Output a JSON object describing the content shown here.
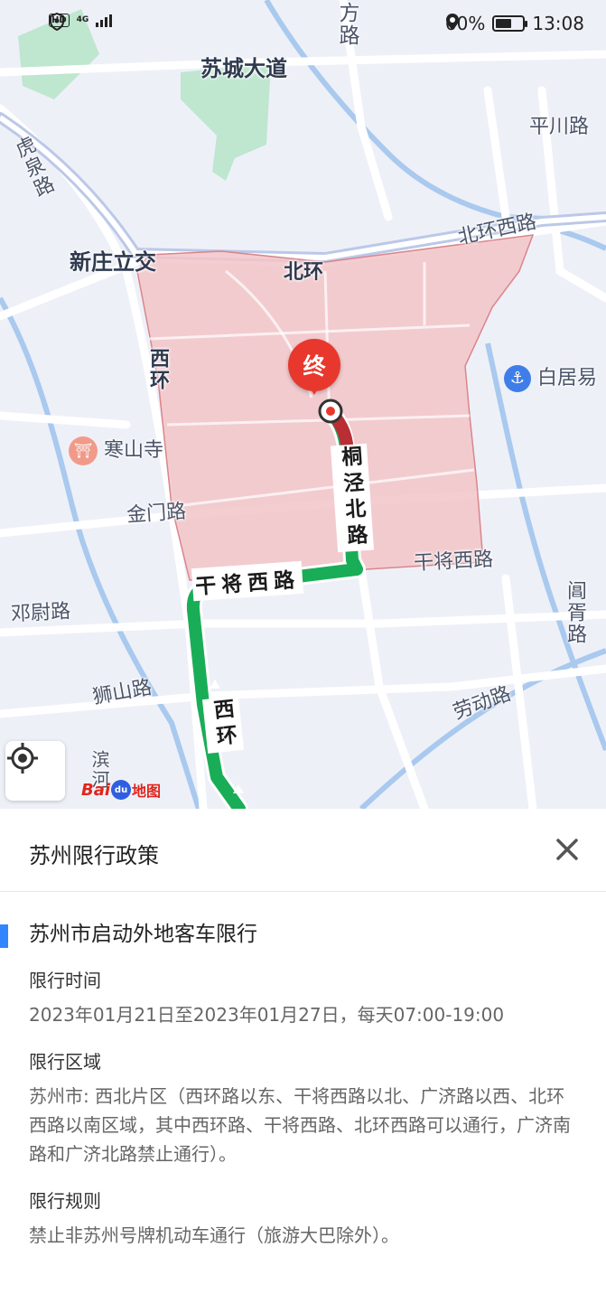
{
  "status_bar": {
    "network_badge": "HD",
    "network_type": "4G",
    "battery_percent": "60%",
    "battery_level": 0.6,
    "time": "13:08",
    "icons": [
      "hd-icon",
      "signal-icon",
      "vpn-shield-icon",
      "location-icon",
      "battery-icon"
    ]
  },
  "map": {
    "roads": {
      "fang_lu_a": "方",
      "fang_lu_b": "路",
      "sucheng_dadao": "苏城大道",
      "pingchuan_lu": "平川路",
      "huquan_lu": "虎泉路",
      "beihuan_xilu_top": "北环西路",
      "xinzhuang_lijiao": "新庄立交",
      "beihuan": "北环",
      "xihuan_top": "西环",
      "bai_ju_yi": "白居易",
      "hanshan_si": "寒山寺",
      "jinmen_lu": "金门路",
      "ganjiang_xilu_right": "干将西路",
      "dengwei_lu": "邓尉路",
      "changxu_lu": "阊胥路",
      "shishan_lu": "狮山路",
      "laodong_lu": "劳动路",
      "bin_he_partial": "滨河"
    },
    "route_labels": {
      "tongjing_beilu": "桐泾北路",
      "ganjiang_xilu": "干将西路",
      "xihuan_bottom": "西环"
    },
    "end_marker": "终",
    "restricted_area_color": "#f2c4c8",
    "route_color": "#1aad57",
    "route_end_color": "#b92e34",
    "logo": "Bai 地图"
  },
  "panel": {
    "title": "苏州限行政策",
    "close_icon": "close-icon",
    "policy_title": "苏州市启动外地客车限行",
    "time_label": "限行时间",
    "time_value": "2023年01月21日至2023年01月27日，每天07:00-19:00",
    "area_label": "限行区域",
    "area_value": "苏州市: 西北片区（西环路以东、干将西路以北、广济路以西、北环西路以南区域，其中西环路、干将西路、北环西路可以通行，广济南路和广济北路禁止通行）。",
    "rule_label": "限行规则",
    "rule_value": "禁止非苏州号牌机动车通行（旅游大巴除外）。"
  }
}
